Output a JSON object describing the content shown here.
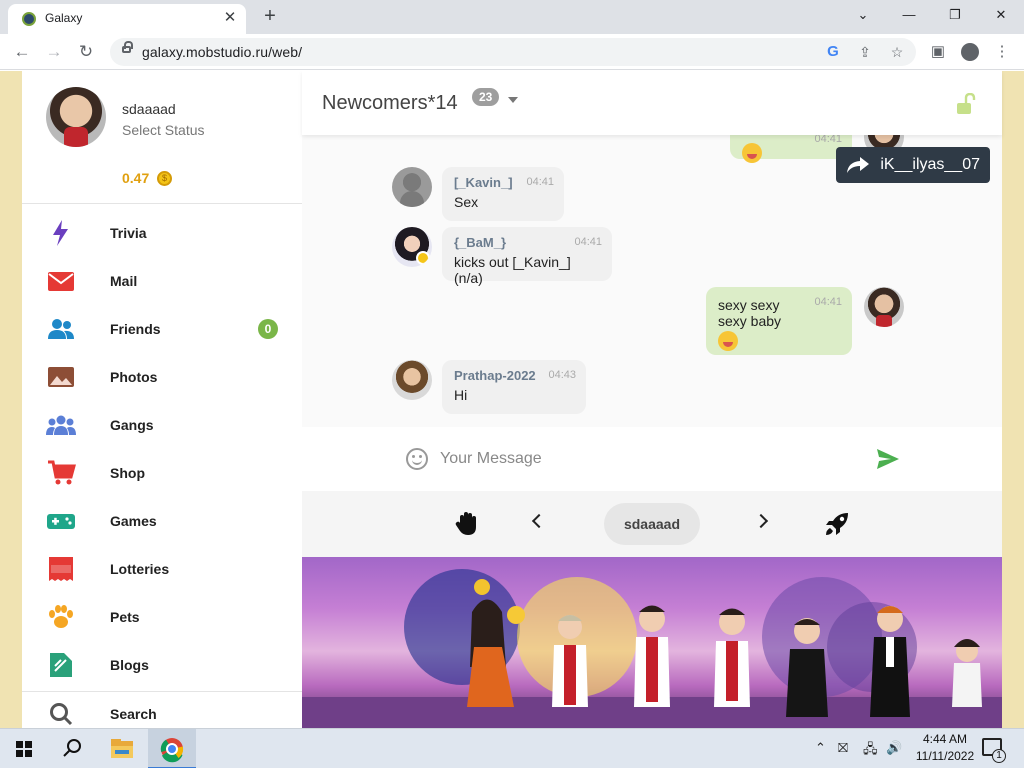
{
  "browser": {
    "tab_title": "Galaxy",
    "tab_close": "✕",
    "new_tab": "+",
    "url": "galaxy.mobstudio.ru/web/",
    "min": "—",
    "max": "❐",
    "close": "✕"
  },
  "profile": {
    "name": "sdaaaad",
    "status": "Select Status",
    "coins": "0.47"
  },
  "menu": [
    {
      "label": "Trivia",
      "icon": "lightning-icon",
      "color": "#6a3fbf"
    },
    {
      "label": "Mail",
      "icon": "mail-icon",
      "color": "#e53935"
    },
    {
      "label": "Friends",
      "icon": "friends-icon",
      "color": "#1e88c8",
      "badge": "0"
    },
    {
      "label": "Photos",
      "icon": "photos-icon",
      "color": "#8d4e36"
    },
    {
      "label": "Gangs",
      "icon": "gangs-icon",
      "color": "#5b7fd6"
    },
    {
      "label": "Shop",
      "icon": "cart-icon",
      "color": "#e53935"
    },
    {
      "label": "Games",
      "icon": "gamepad-icon",
      "color": "#1fa68a"
    },
    {
      "label": "Lotteries",
      "icon": "ticket-icon",
      "color": "#e53935"
    },
    {
      "label": "Pets",
      "icon": "paw-icon",
      "color": "#f5a623"
    },
    {
      "label": "Blogs",
      "icon": "blog-icon",
      "color": "#2aa17a"
    },
    {
      "label": "Search",
      "icon": "search-icon",
      "color": "#555555"
    }
  ],
  "chat": {
    "room_title": "Newcomers*14",
    "user_count": "23",
    "forward_user": "iK__ilyas__07",
    "top_partial_time": "04:41",
    "messages": [
      {
        "author": "[_Kavin_]",
        "time": "04:41",
        "text": "Sex"
      },
      {
        "author": "{_BaM_}",
        "time": "04:41",
        "text": "kicks out [_Kavin_] (n/a)"
      },
      {
        "author": "",
        "time": "04:41",
        "text": "sexy sexy",
        "text2": "sexy baby",
        "own": true
      },
      {
        "author": "Prathap-2022",
        "time": "04:43",
        "text": "Hi"
      }
    ],
    "input_placeholder": "Your Message",
    "current_user": "sdaaaad"
  },
  "taskbar": {
    "time": "4:44 AM",
    "date": "11/11/2022",
    "notif_count": "1"
  },
  "colors": {
    "accent_green": "#7ab648",
    "send_green": "#4caf50",
    "own_bubble": "#dcedc8"
  }
}
